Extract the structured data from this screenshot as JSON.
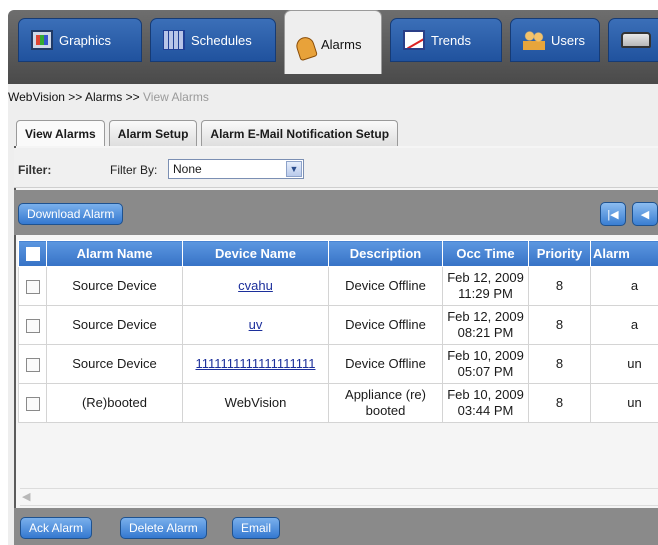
{
  "top_tabs": [
    {
      "label": "Graphics",
      "icon": "graphics-icon"
    },
    {
      "label": "Schedules",
      "icon": "schedule-icon"
    },
    {
      "label": "Alarms",
      "icon": "alarm-bell-icon"
    },
    {
      "label": "Trends",
      "icon": "trends-chart-icon"
    },
    {
      "label": "Users",
      "icon": "users-icon"
    },
    {
      "label": "",
      "icon": "device-icon"
    }
  ],
  "breadcrumb": {
    "root": "WebVision",
    "sep1": ">>",
    "section": "Alarms",
    "sep2": ">>",
    "current": "View Alarms"
  },
  "sub_tabs": [
    "View Alarms",
    "Alarm Setup",
    "Alarm E-Mail Notification Setup"
  ],
  "filter": {
    "label": "Filter:",
    "by_label": "Filter By:",
    "value": "None"
  },
  "buttons": {
    "download": "Download Alarm",
    "ack": "Ack Alarm",
    "delete": "Delete Alarm",
    "email": "Email"
  },
  "pager": {
    "first": "first-page-icon",
    "prev": "previous-page-icon"
  },
  "table": {
    "columns": [
      "Alarm Name",
      "Device Name",
      "Description",
      "Occ Time",
      "Priority",
      "Alarm"
    ],
    "rows": [
      {
        "alarm_name": "Source Device",
        "device_name": "cvahu",
        "description": "Device Offline",
        "occ_date": "Feb 12, 2009",
        "occ_time": "11:29 PM",
        "priority": "8",
        "alarm": "a"
      },
      {
        "alarm_name": "Source Device",
        "device_name": "uv",
        "description": "Device Offline",
        "occ_date": "Feb 12, 2009",
        "occ_time": "08:21 PM",
        "priority": "8",
        "alarm": "a"
      },
      {
        "alarm_name": "Source Device",
        "device_name": "1111111111111111111",
        "description": "Device Offline",
        "occ_date": "Feb 10, 2009",
        "occ_time": "05:07 PM",
        "priority": "8",
        "alarm": "un"
      },
      {
        "alarm_name": "(Re)booted",
        "device_name": "WebVision",
        "description": "Appliance (re) booted",
        "occ_date": "Feb 10, 2009",
        "occ_time": "03:44 PM",
        "priority": "8",
        "alarm": "un"
      }
    ]
  },
  "colors": {
    "header_blue": "#3f7fd0",
    "top_bar": "#5a5a5a",
    "tab_blue": "#2c5fab",
    "link": "#1c2f9b"
  }
}
